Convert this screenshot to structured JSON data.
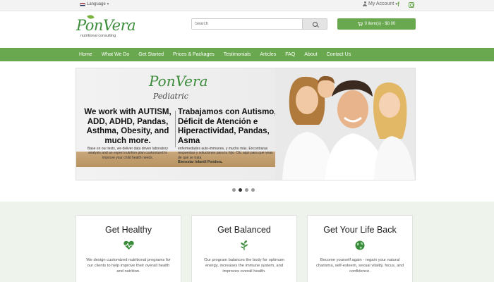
{
  "topbar": {
    "language_label": "Language",
    "account_label": "My Account"
  },
  "header": {
    "logo_text": "PonVera",
    "logo_tagline": "nutritional consulting",
    "search_placeholder": "Search",
    "cart_label": "0 item(s) - $0.00"
  },
  "nav": {
    "items": [
      "Home",
      "What We Do",
      "Get Started",
      "Prices & Packages",
      "Testimonials",
      "Articles",
      "FAQ",
      "About",
      "Contact Us"
    ]
  },
  "slide": {
    "logo_text": "PonVera",
    "logo_sub": "Pediatric",
    "en_heading": "We work with AUTISM, ADD, ADHD, Pandas, Asthma, Obesity, and much more.",
    "en_body": "Base on our tests, we deliver data driven laboratory analysis and an expert nutrition plan customized to improve your child health needs.",
    "es_heading": "Trabajamos con Autismo, Déficit de Atención e Hiperactividad, Pandas, Asma",
    "es_body": "enfermedades auto-immunes, y mucho más. Encontraras respuestas y soluciones para tu hijo. Clic aqui para que veas de qué se trata",
    "es_body_bold": "Bienestar Infantil Pondera."
  },
  "carousel": {
    "count": 4,
    "active_index": 1
  },
  "features": [
    {
      "title": "Get Healthy",
      "icon": "heartbeat-icon",
      "text": "We design customized nutritional programs for our clients to help improve their overall health and nutrition."
    },
    {
      "title": "Get Balanced",
      "icon": "leaf-icon",
      "text": "Our program balances the body for optimum energy, increases the immune system, and improves overall health."
    },
    {
      "title": "Get Your Life Back",
      "icon": "globe-icon",
      "text": "Become yourself again - regain your natural charisma, self-esteem, sexual vitality, focus, and confidence."
    }
  ],
  "colors": {
    "brand_green": "#6aa84f",
    "logo_green": "#3b8d3b",
    "bottom_bg": "#eef3ec"
  }
}
